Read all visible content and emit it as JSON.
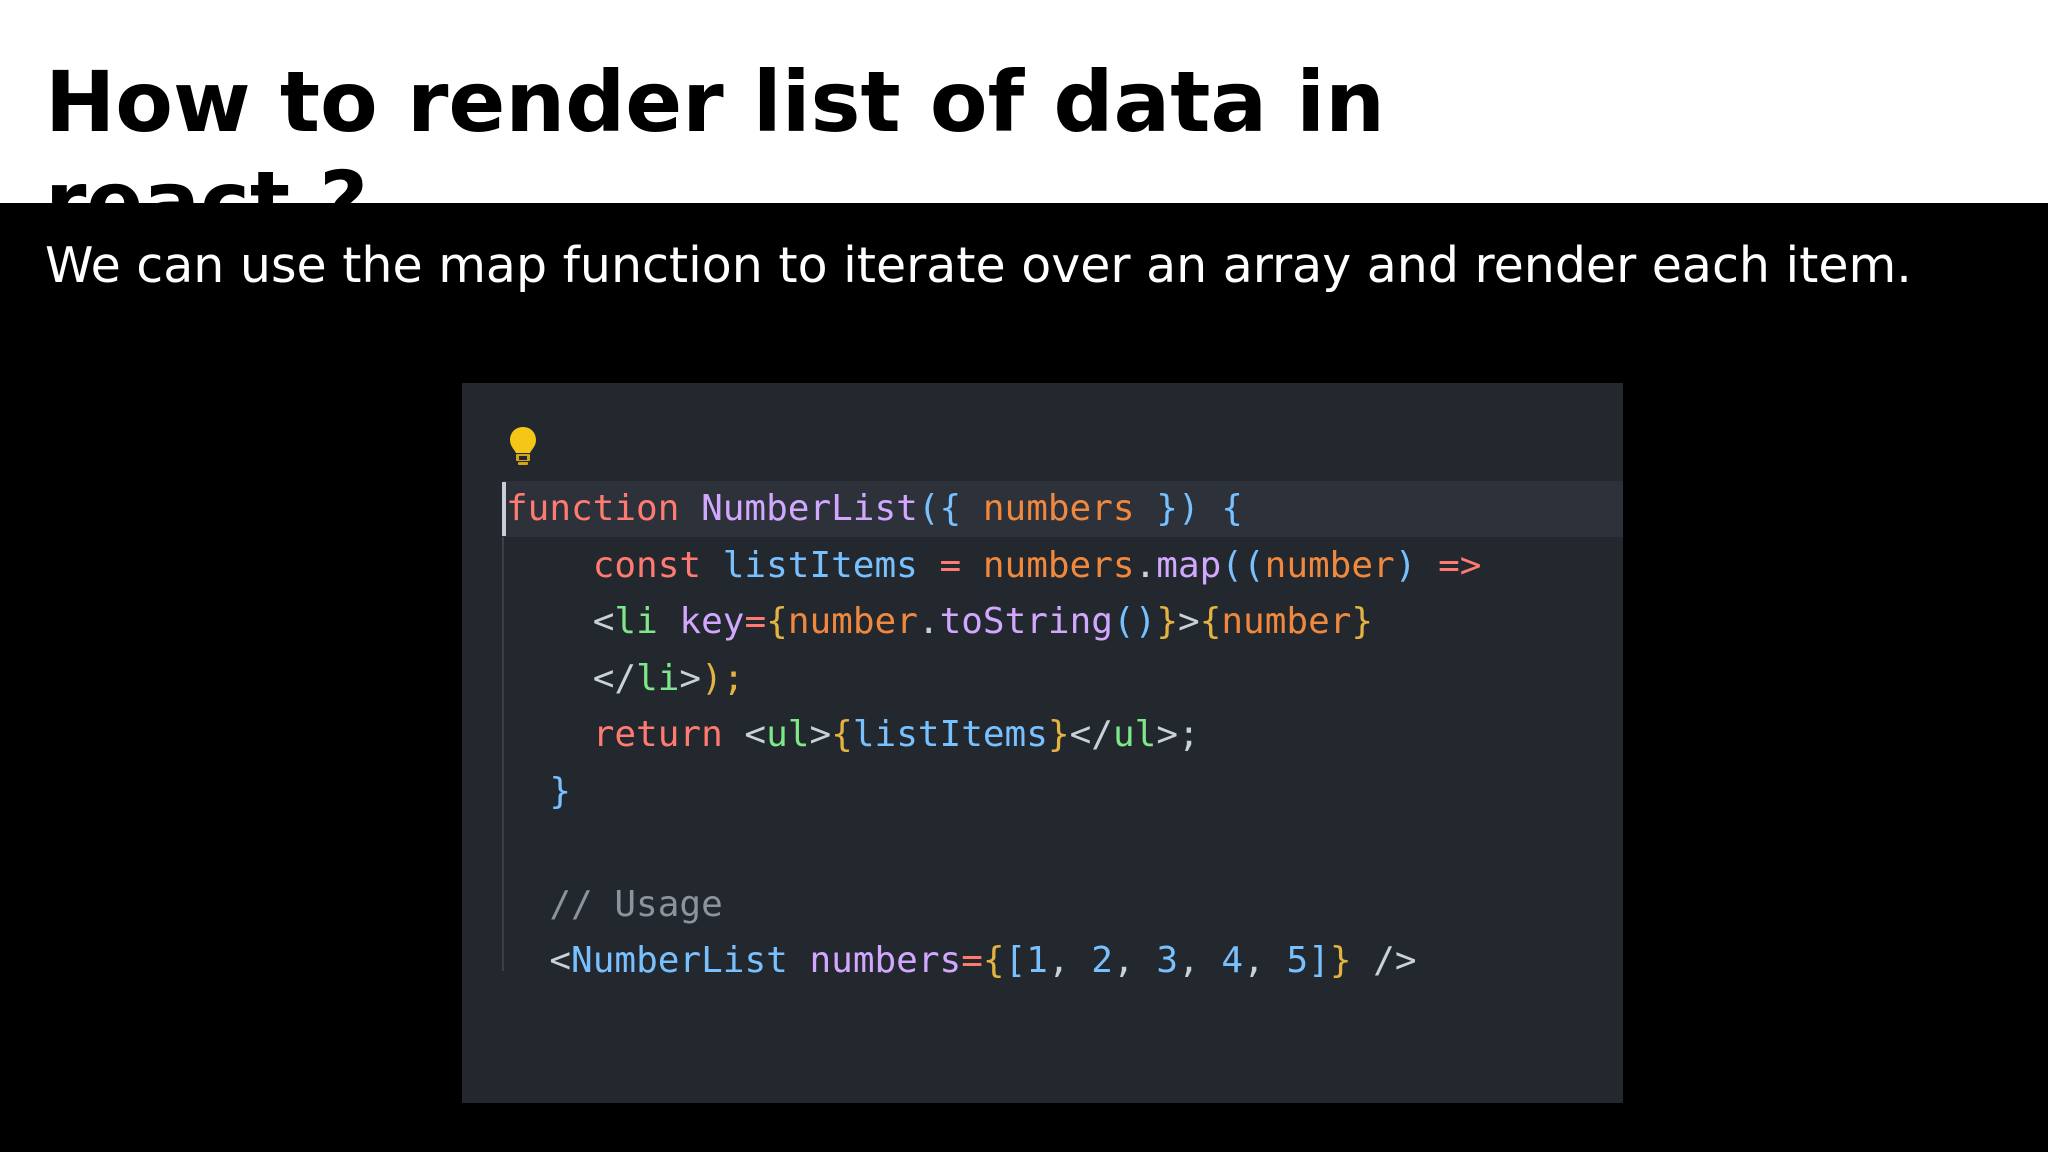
{
  "slide": {
    "title": "How to render list of data in react ?",
    "subtitle": "We can use the map function to iterate over an array and render each item."
  },
  "code": {
    "lines": [
      [
        {
          "t": "function",
          "c": "keyword"
        },
        {
          "t": " ",
          "c": "plain"
        },
        {
          "t": "NumberList",
          "c": "func"
        },
        {
          "t": "({",
          "c": "punct"
        },
        {
          "t": " numbers ",
          "c": "ident"
        },
        {
          "t": "})",
          "c": "punct"
        },
        {
          "t": " {",
          "c": "punct"
        }
      ],
      [
        {
          "t": "    ",
          "c": "plain"
        },
        {
          "t": "const",
          "c": "keyword"
        },
        {
          "t": " listItems ",
          "c": "punct"
        },
        {
          "t": "=",
          "c": "op"
        },
        {
          "t": " numbers",
          "c": "ident"
        },
        {
          "t": ".",
          "c": "plain"
        },
        {
          "t": "map",
          "c": "func"
        },
        {
          "t": "((",
          "c": "punct"
        },
        {
          "t": "number",
          "c": "ident"
        },
        {
          "t": ")",
          "c": "punct"
        },
        {
          "t": " =>",
          "c": "op"
        }
      ],
      [
        {
          "t": "    ",
          "c": "plain"
        },
        {
          "t": "<",
          "c": "plain"
        },
        {
          "t": "li",
          "c": "tag"
        },
        {
          "t": " key",
          "c": "attr"
        },
        {
          "t": "=",
          "c": "op"
        },
        {
          "t": "{",
          "c": "brace"
        },
        {
          "t": "number",
          "c": "ident"
        },
        {
          "t": ".",
          "c": "plain"
        },
        {
          "t": "toString",
          "c": "func"
        },
        {
          "t": "()",
          "c": "punct"
        },
        {
          "t": "}",
          "c": "brace"
        },
        {
          "t": ">",
          "c": "plain"
        },
        {
          "t": "{",
          "c": "brace"
        },
        {
          "t": "number",
          "c": "ident"
        },
        {
          "t": "}",
          "c": "brace"
        }
      ],
      [
        {
          "t": "    ",
          "c": "plain"
        },
        {
          "t": "</",
          "c": "plain"
        },
        {
          "t": "li",
          "c": "tag"
        },
        {
          "t": ">",
          "c": "plain"
        },
        {
          "t": ");",
          "c": "brace"
        }
      ],
      [
        {
          "t": "    ",
          "c": "plain"
        },
        {
          "t": "return",
          "c": "keyword"
        },
        {
          "t": " <",
          "c": "plain"
        },
        {
          "t": "ul",
          "c": "tag"
        },
        {
          "t": ">",
          "c": "plain"
        },
        {
          "t": "{",
          "c": "brace"
        },
        {
          "t": "listItems",
          "c": "punct"
        },
        {
          "t": "}",
          "c": "brace"
        },
        {
          "t": "</",
          "c": "plain"
        },
        {
          "t": "ul",
          "c": "tag"
        },
        {
          "t": ">;",
          "c": "plain"
        }
      ],
      [
        {
          "t": "  ",
          "c": "plain"
        },
        {
          "t": "}",
          "c": "punct"
        }
      ],
      [],
      [
        {
          "t": "  ",
          "c": "plain"
        },
        {
          "t": "// Usage",
          "c": "comment"
        }
      ],
      [
        {
          "t": "  ",
          "c": "plain"
        },
        {
          "t": "<",
          "c": "plain"
        },
        {
          "t": "NumberList",
          "c": "punct"
        },
        {
          "t": " numbers",
          "c": "attr"
        },
        {
          "t": "=",
          "c": "op"
        },
        {
          "t": "{",
          "c": "brace"
        },
        {
          "t": "[",
          "c": "punct"
        },
        {
          "t": "1",
          "c": "number"
        },
        {
          "t": ", ",
          "c": "plain"
        },
        {
          "t": "2",
          "c": "number"
        },
        {
          "t": ", ",
          "c": "plain"
        },
        {
          "t": "3",
          "c": "number"
        },
        {
          "t": ", ",
          "c": "plain"
        },
        {
          "t": "4",
          "c": "number"
        },
        {
          "t": ", ",
          "c": "plain"
        },
        {
          "t": "5",
          "c": "number"
        },
        {
          "t": "]",
          "c": "punct"
        },
        {
          "t": "}",
          "c": "brace"
        },
        {
          "t": " />",
          "c": "plain"
        }
      ]
    ]
  },
  "colors": {
    "title_band": "#ffffff",
    "body_background": "#000000",
    "code_background": "#23272e",
    "bulb": "#f5c518"
  },
  "icons": {
    "hint": "lightbulb-icon"
  }
}
